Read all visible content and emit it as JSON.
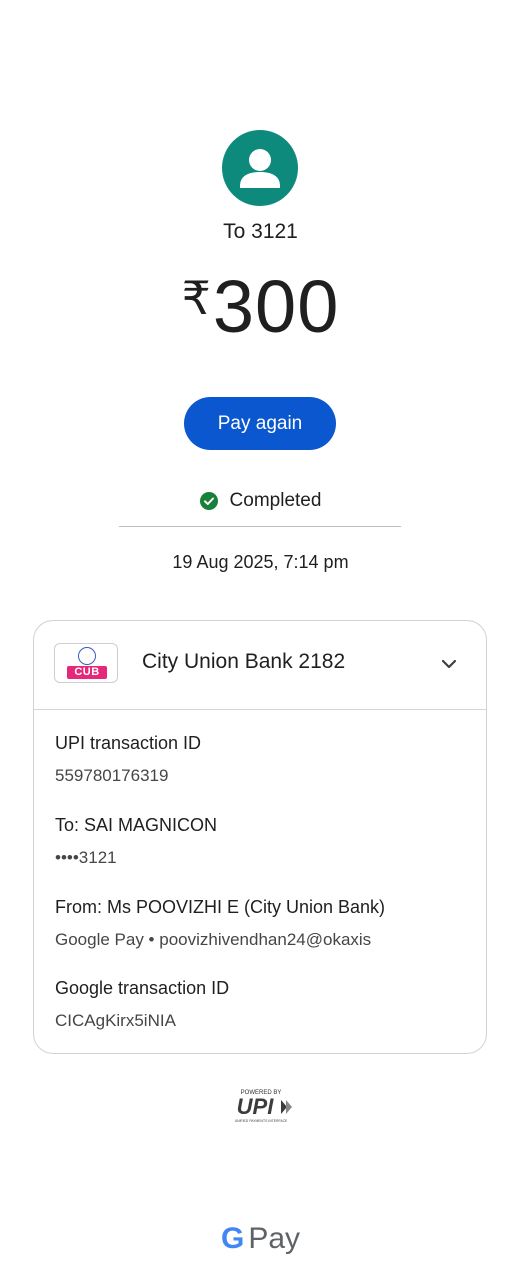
{
  "recipient": {
    "avatar_icon": "person-icon",
    "to_label": "To 3121"
  },
  "payment": {
    "currency_symbol": "₹",
    "amount": "300",
    "pay_again_label": "Pay again",
    "status": "Completed",
    "datetime": "19 Aug 2025, 7:14 pm"
  },
  "card": {
    "bank_logo_text": "CUB",
    "bank_name": "City Union Bank 2182",
    "chevron_icon": "chevron-down-icon",
    "details": [
      {
        "label": "UPI transaction ID",
        "value": "559780176319"
      },
      {
        "label": "To: SAI MAGNICON",
        "value": "••••3121"
      },
      {
        "label": "From: Ms POOVIZHI  E (City Union Bank)",
        "value": "Google Pay • poovizhivendhan24@okaxis"
      },
      {
        "label": "Google transaction ID",
        "value": "CICAgKirx5iNIA"
      }
    ]
  },
  "footer": {
    "powered_by": "POWERED BY",
    "upi_text": "UPI",
    "upi_tagline": "UNIFIED PAYMENTS INTERFACE",
    "gpay_g": "G",
    "gpay_pay": "Pay"
  },
  "colors": {
    "accent": "#0b57d0",
    "avatar": "#0e8a7d",
    "success": "#188038",
    "cub_pink": "#e6287a"
  }
}
